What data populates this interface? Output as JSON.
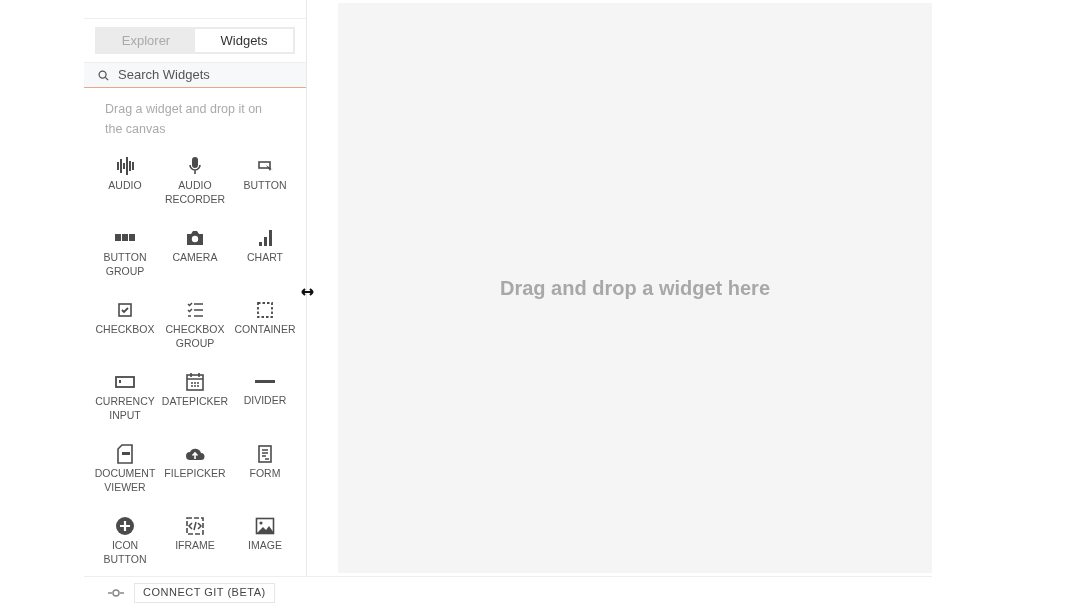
{
  "tabs": [
    {
      "label": "Explorer",
      "selected": false
    },
    {
      "label": "Widgets",
      "selected": true
    }
  ],
  "search": {
    "placeholder": "Search Widgets"
  },
  "hint": "Drag a widget and drop it on the canvas",
  "widgets": [
    {
      "kind": "audio",
      "label": "AUDIO"
    },
    {
      "kind": "recorder",
      "label": "AUDIO RECORDER"
    },
    {
      "kind": "button",
      "label": "BUTTON"
    },
    {
      "kind": "buttongroup",
      "label": "BUTTON GROUP"
    },
    {
      "kind": "camera",
      "label": "CAMERA"
    },
    {
      "kind": "chart",
      "label": "CHART"
    },
    {
      "kind": "checkbox",
      "label": "CHECKBOX"
    },
    {
      "kind": "checklist",
      "label": "CHECKBOX GROUP"
    },
    {
      "kind": "container",
      "label": "CONTAINER"
    },
    {
      "kind": "currency",
      "label": "CURRENCY INPUT"
    },
    {
      "kind": "calendar",
      "label": "DATEPICKER"
    },
    {
      "kind": "divider",
      "label": "DIVIDER"
    },
    {
      "kind": "pdf",
      "label": "DOCUMENT VIEWER"
    },
    {
      "kind": "upload",
      "label": "FILEPICKER"
    },
    {
      "kind": "form",
      "label": "FORM"
    },
    {
      "kind": "plus",
      "label": "ICON BUTTON"
    },
    {
      "kind": "code",
      "label": "IFRAME"
    },
    {
      "kind": "image",
      "label": "IMAGE"
    }
  ],
  "canvas": {
    "message": "Drag and drop a widget here"
  },
  "git_button": "CONNECT GIT (BETA)"
}
